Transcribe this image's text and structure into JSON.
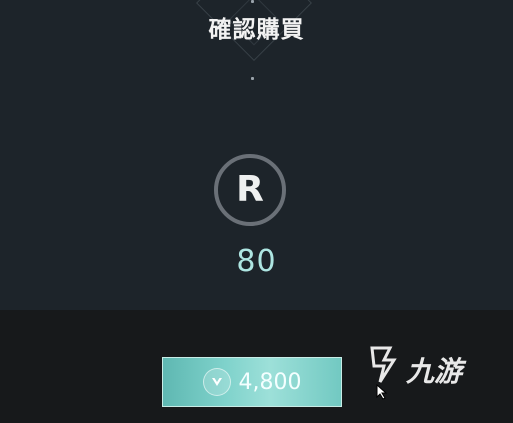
{
  "dialog": {
    "title": "確認購買"
  },
  "item": {
    "currency_icon": "radianite-icon",
    "currency_letter": "R",
    "amount": "80"
  },
  "purchase_button": {
    "icon": "valorant-points-icon",
    "price": "4,800"
  },
  "watermark": {
    "text": "九游"
  },
  "colors": {
    "background_top": "#1d242a",
    "background_bottom": "#17191b",
    "accent": "#7fd2cb",
    "amount_text": "#aee6e2"
  }
}
